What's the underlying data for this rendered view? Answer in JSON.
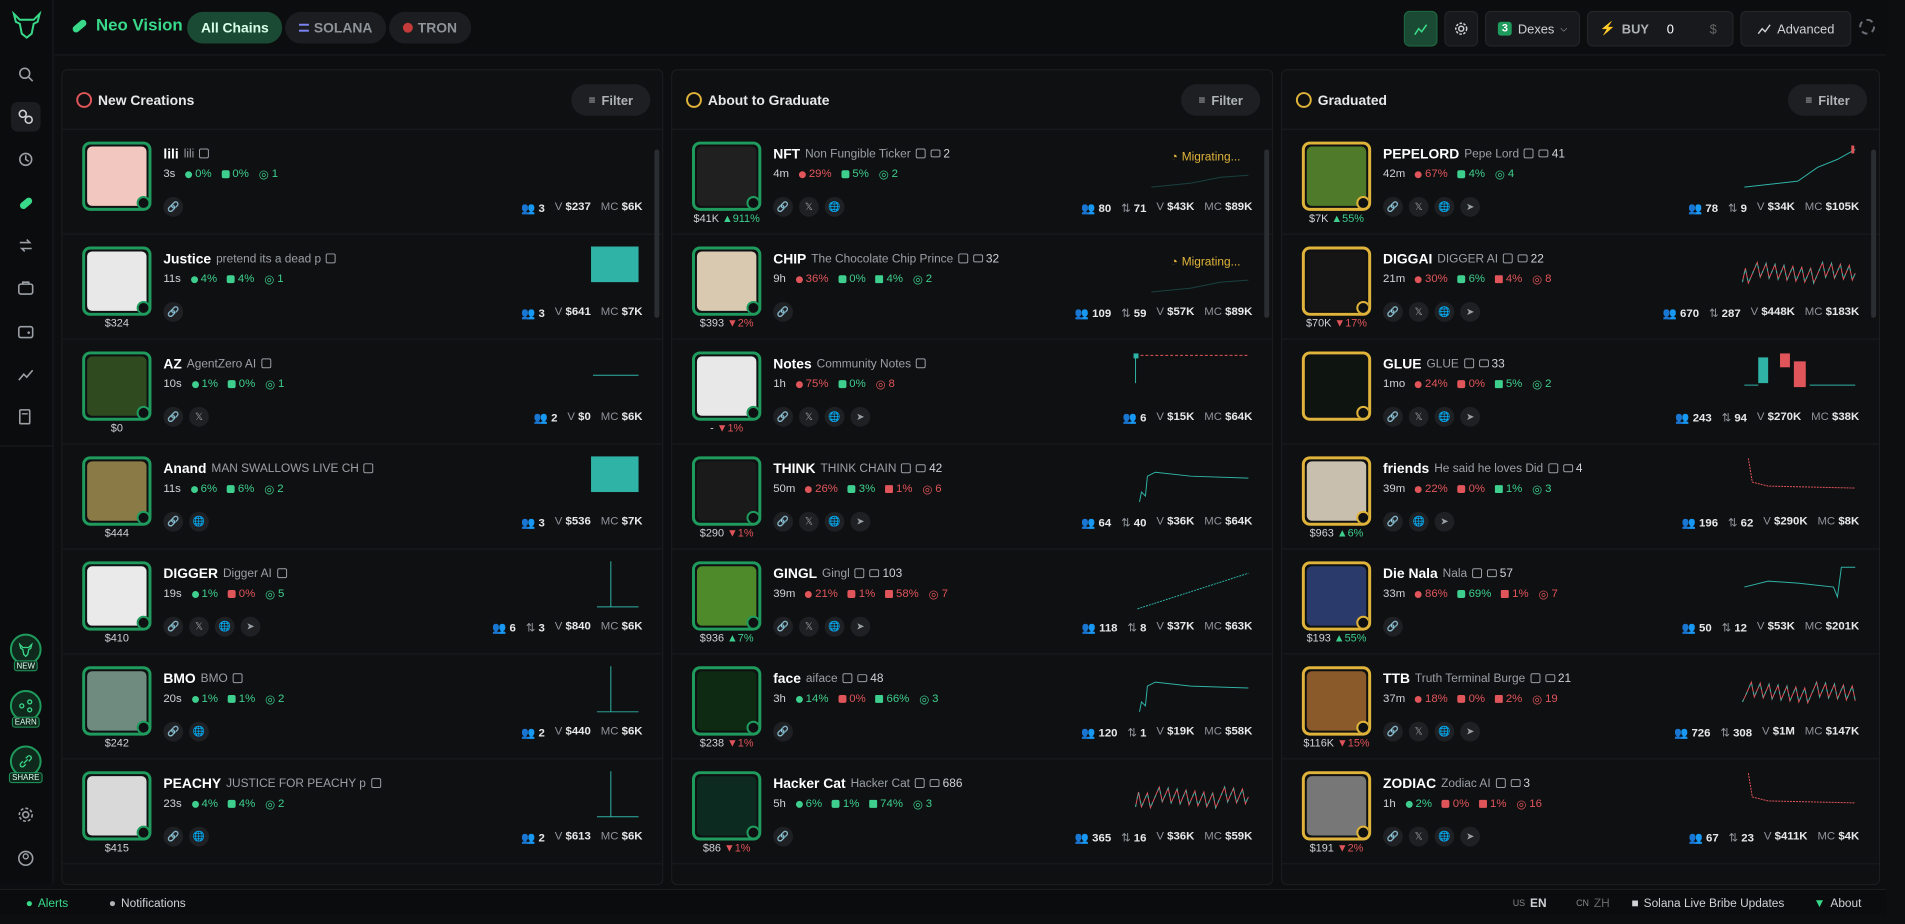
{
  "brand": {
    "name": "Neo Vision"
  },
  "chains": [
    {
      "label": "All Chains",
      "active": true
    },
    {
      "label": "SOLANA",
      "active": false
    },
    {
      "label": "TRON",
      "active": false
    }
  ],
  "toolbar": {
    "dex_count": "3",
    "dex_label": "Dexes",
    "buy_label": "BUY",
    "buy_value": "0",
    "currency": "$",
    "advanced_label": "Advanced"
  },
  "sidebar": {
    "new": "NEW",
    "earn": "EARN",
    "share": "SHARE"
  },
  "filter_label": "Filter",
  "columns": [
    {
      "title": "New Creations",
      "rows": [
        {
          "ticker": "lili",
          "name": "lili",
          "age": "3s",
          "p1": "0%",
          "p2": "0%",
          "p3": "1",
          "comments": "",
          "price": "",
          "change": "",
          "holders": "3",
          "tx": "",
          "vol": "$237",
          "mc": "$6K",
          "chart": "none",
          "social": [
            "link"
          ],
          "color": "#f2c7bf"
        },
        {
          "ticker": "Justice",
          "name": "pretend its a dead p",
          "age": "11s",
          "p1": "4%",
          "p2": "4%",
          "p3": "1",
          "comments": "",
          "price": "$324",
          "change": "",
          "holders": "3",
          "tx": "",
          "vol": "$641",
          "mc": "$7K",
          "chart": "block",
          "social": [
            "link"
          ],
          "color": "#e8e8e8"
        },
        {
          "ticker": "AZ",
          "name": "AgentZero AI",
          "age": "10s",
          "p1": "1%",
          "p2": "0%",
          "p3": "1",
          "comments": "",
          "price": "$0",
          "change": "",
          "holders": "2",
          "tx": "",
          "vol": "$0",
          "mc": "$6K",
          "chart": "flat",
          "social": [
            "link",
            "x"
          ],
          "color": "#2f4a1f"
        },
        {
          "ticker": "Anand",
          "name": "MAN SWALLOWS LIVE CH",
          "age": "11s",
          "p1": "6%",
          "p2": "6%",
          "p3": "2",
          "comments": "",
          "price": "$444",
          "change": "",
          "holders": "3",
          "tx": "",
          "vol": "$536",
          "mc": "$7K",
          "chart": "block",
          "social": [
            "link",
            "web"
          ],
          "color": "#8a7a45"
        },
        {
          "ticker": "DIGGER",
          "name": "Digger AI",
          "age": "19s",
          "p1": "1%",
          "p2": "0%",
          "p3": "5",
          "comments": "",
          "price": "$410",
          "change": "",
          "holders": "6",
          "tx": "3",
          "vol": "$840",
          "mc": "$6K",
          "chart": "spike",
          "social": [
            "link",
            "x",
            "web",
            "tg"
          ],
          "color": "#eaeaea",
          "red2": true
        },
        {
          "ticker": "BMO",
          "name": "BMO",
          "age": "20s",
          "p1": "1%",
          "p2": "1%",
          "p3": "2",
          "comments": "",
          "price": "$242",
          "change": "",
          "holders": "2",
          "tx": "",
          "vol": "$440",
          "mc": "$6K",
          "chart": "spike",
          "social": [
            "link",
            "web"
          ],
          "color": "#6f8a7e"
        },
        {
          "ticker": "PEACHY",
          "name": "JUSTICE FOR PEACHY p",
          "age": "23s",
          "p1": "4%",
          "p2": "4%",
          "p3": "2",
          "comments": "",
          "price": "$415",
          "change": "",
          "holders": "2",
          "tx": "",
          "vol": "$613",
          "mc": "$6K",
          "chart": "spike",
          "social": [
            "link",
            "web"
          ],
          "color": "#d9d9d9"
        }
      ]
    },
    {
      "title": "About to Graduate",
      "rows": [
        {
          "ticker": "NFT",
          "name": "Non Fungible Ticker",
          "age": "4m",
          "p1": "29%",
          "p2": "5%",
          "p3": "2",
          "comments": "2",
          "price": "$41K",
          "change": "911%",
          "up": true,
          "holders": "80",
          "tx": "71",
          "vol": "$43K",
          "mc": "$89K",
          "chart": "migrating",
          "social": [
            "link",
            "x",
            "web"
          ],
          "color": "#202020",
          "red": true
        },
        {
          "ticker": "CHIP",
          "name": "The Chocolate Chip Prince",
          "age": "9h",
          "p1": "36%",
          "p2": "0%",
          "p3": "2",
          "p4": "4%",
          "comments": "32",
          "price": "$393",
          "change": "2%",
          "up": false,
          "holders": "109",
          "tx": "59",
          "vol": "$57K",
          "mc": "$89K",
          "chart": "migrating",
          "social": [
            "link"
          ],
          "color": "#d9c9b0",
          "red": true
        },
        {
          "ticker": "Notes",
          "name": "Community Notes",
          "age": "1h",
          "p1": "75%",
          "p2": "0%",
          "p3": "8",
          "comments": "",
          "price": "-",
          "change": "1%",
          "up": false,
          "holders": "6",
          "tx": "",
          "vol": "$15K",
          "mc": "$64K",
          "chart": "notes",
          "social": [
            "link",
            "x",
            "web",
            "tg"
          ],
          "color": "#e8e8e8",
          "red": true,
          "red3": true
        },
        {
          "ticker": "THINK",
          "name": "THINK CHAIN",
          "age": "50m",
          "p1": "26%",
          "p2": "3%",
          "p3": "6",
          "p4": "1%",
          "comments": "42",
          "price": "$290",
          "change": "1%",
          "up": false,
          "holders": "64",
          "tx": "40",
          "vol": "$36K",
          "mc": "$64K",
          "chart": "rise",
          "social": [
            "link",
            "x",
            "web",
            "tg"
          ],
          "color": "#1a1a1a",
          "red": true,
          "red3": true
        },
        {
          "ticker": "GINGL",
          "name": "Gingl",
          "age": "39m",
          "p1": "21%",
          "p2": "1%",
          "p3": "7",
          "p4": "58%",
          "comments": "103",
          "price": "$936",
          "change": "7%",
          "up": true,
          "holders": "118",
          "tx": "8",
          "vol": "$37K",
          "mc": "$63K",
          "chart": "slope",
          "social": [
            "link",
            "x",
            "web",
            "tg"
          ],
          "color": "#4f8a2a",
          "red": true,
          "red2": true,
          "red3": true
        },
        {
          "ticker": "face",
          "name": "aiface",
          "age": "3h",
          "p1": "14%",
          "p2": "0%",
          "p3": "3",
          "p4": "66%",
          "comments": "48",
          "price": "$238",
          "change": "1%",
          "up": false,
          "holders": "120",
          "tx": "1",
          "vol": "$19K",
          "mc": "$58K",
          "chart": "rise",
          "social": [
            "link"
          ],
          "color": "#0f2a12",
          "red2": true
        },
        {
          "ticker": "Hacker Cat",
          "name": "Hacker Cat",
          "age": "5h",
          "p1": "6%",
          "p2": "1%",
          "p3": "3",
          "p4": "74%",
          "comments": "686",
          "price": "$86",
          "change": "1%",
          "up": false,
          "holders": "365",
          "tx": "16",
          "vol": "$36K",
          "mc": "$59K",
          "chart": "noisy",
          "social": [
            "link"
          ],
          "color": "#0d2a20"
        }
      ]
    },
    {
      "title": "Graduated",
      "rows": [
        {
          "ticker": "PEPELORD",
          "name": "Pepe Lord",
          "age": "42m",
          "p1": "67%",
          "p2": "4%",
          "p3": "4",
          "comments": "41",
          "price": "$7K",
          "change": "55%",
          "up": true,
          "holders": "78",
          "tx": "9",
          "vol": "$34K",
          "mc": "$105K",
          "chart": "pepe",
          "social": [
            "link",
            "x",
            "web",
            "tg"
          ],
          "color": "#4f7a2a",
          "red": true
        },
        {
          "ticker": "DIGGAI",
          "name": "DIGGER AI",
          "age": "21m",
          "p1": "30%",
          "p2": "6%",
          "p3": "8",
          "p4": "4%",
          "comments": "22",
          "price": "$70K",
          "change": "17%",
          "up": false,
          "holders": "670",
          "tx": "287",
          "vol": "$448K",
          "mc": "$183K",
          "chart": "noisy",
          "social": [
            "link",
            "x",
            "web",
            "tg"
          ],
          "color": "#151515",
          "red": true,
          "red3": true
        },
        {
          "ticker": "GLUE",
          "name": "GLUE",
          "age": "1mo",
          "p1": "24%",
          "p2": "0%",
          "p3": "2",
          "p4": "5%",
          "comments": "33",
          "price": "",
          "change": "",
          "holders": "243",
          "tx": "94",
          "vol": "$270K",
          "mc": "$38K",
          "chart": "glue",
          "social": [
            "link",
            "x",
            "web",
            "tg"
          ],
          "color": "#0e1410",
          "red": true,
          "red2": true
        },
        {
          "ticker": "friends",
          "name": "He said he loves Did",
          "age": "39m",
          "p1": "22%",
          "p2": "0%",
          "p3": "3",
          "p4": "1%",
          "comments": "4",
          "price": "$963",
          "change": "6%",
          "up": true,
          "holders": "196",
          "tx": "62",
          "vol": "$290K",
          "mc": "$8K",
          "chart": "drop",
          "social": [
            "link",
            "web",
            "tg"
          ],
          "color": "#c9bfae",
          "red": true,
          "red2": true
        },
        {
          "ticker": "Die Nala",
          "name": "Nala",
          "age": "33m",
          "p1": "86%",
          "p2": "69%",
          "p3": "7",
          "p4": "1%",
          "comments": "57",
          "price": "$193",
          "change": "55%",
          "up": true,
          "holders": "50",
          "tx": "12",
          "vol": "$53K",
          "mc": "$201K",
          "chart": "nala",
          "social": [
            "link"
          ],
          "color": "#2a3a6a",
          "red": true,
          "red3": true
        },
        {
          "ticker": "TTB",
          "name": "Truth Terminal Burge",
          "age": "37m",
          "p1": "18%",
          "p2": "0%",
          "p3": "19",
          "p4": "2%",
          "comments": "21",
          "price": "$116K",
          "change": "15%",
          "up": false,
          "holders": "726",
          "tx": "308",
          "vol": "$1M",
          "mc": "$147K",
          "chart": "noisy",
          "social": [
            "link",
            "x",
            "web",
            "tg"
          ],
          "color": "#8a5a2a",
          "red": true,
          "red2": true,
          "red3": true
        },
        {
          "ticker": "ZODIAC",
          "name": "Zodiac AI",
          "age": "1h",
          "p1": "2%",
          "p2": "0%",
          "p3": "16",
          "p4": "1%",
          "comments": "3",
          "price": "$191",
          "change": "2%",
          "up": false,
          "holders": "67",
          "tx": "23",
          "vol": "$411K",
          "mc": "$4K",
          "chart": "drop",
          "social": [
            "link",
            "x",
            "web",
            "tg"
          ],
          "color": "#777",
          "red2": true,
          "red3": true
        }
      ]
    }
  ],
  "footer": {
    "alerts": "Alerts",
    "notifications": "Notifications",
    "lang_us": "US",
    "lang_en": "EN",
    "lang_cn": "CN",
    "lang_zh": "ZH",
    "bribe": "Solana Live Bribe Updates",
    "about": "About"
  },
  "migrating_label": "Migrating..."
}
